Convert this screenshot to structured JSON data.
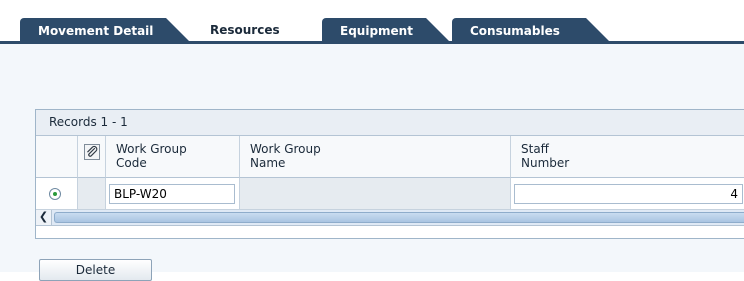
{
  "tabs": [
    {
      "label": "Movement Detail",
      "active": false
    },
    {
      "label": "Resources",
      "active": true
    },
    {
      "label": "Equipment",
      "active": false
    },
    {
      "label": "Consumables",
      "active": false
    }
  ],
  "grid": {
    "records_label": "Records 1 - 1",
    "columns": [
      {
        "line1": "Work Group",
        "line2": "Code"
      },
      {
        "line1": "Work Group",
        "line2": "Name"
      },
      {
        "line1": "Staff",
        "line2": "Number"
      }
    ],
    "rows": [
      {
        "selected": true,
        "work_group_code": "BLP-W20",
        "work_group_name": "",
        "staff_number": "4"
      }
    ]
  },
  "actions": {
    "delete_label": "Delete"
  },
  "colors": {
    "tab_dark": "#2d4b6a",
    "content_bg": "#f3f7fb",
    "grid_border": "#9fb5c9",
    "radio_selected": "#2a9a3a"
  },
  "icons": {
    "attachment_header": "paperclip-icon",
    "scroll_left": "chevron-left-icon"
  }
}
